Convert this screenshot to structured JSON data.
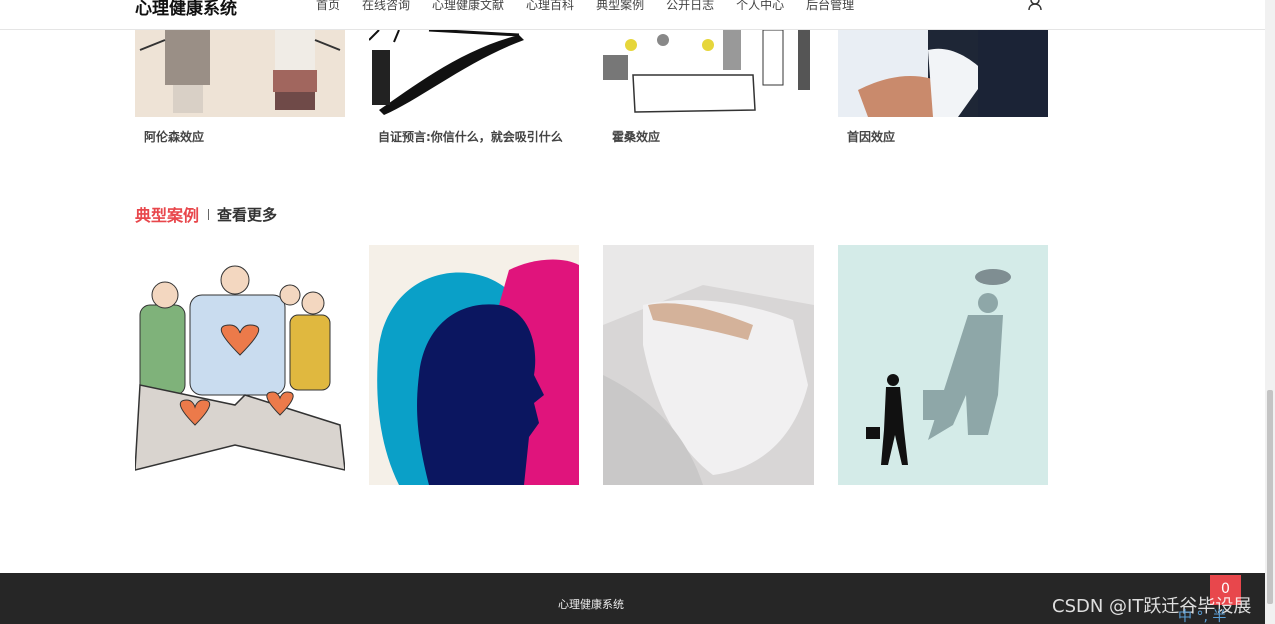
{
  "header": {
    "brand": "心理健康系统",
    "nav": [
      "首页",
      "在线咨询",
      "心理健康文献",
      "心理百科",
      "典型案例",
      "公开日志",
      "个人中心",
      "后台管理"
    ],
    "user_icon": "user-icon"
  },
  "effects": {
    "items": [
      {
        "title": "阿伦森效应",
        "image": "cartoon-couple-image"
      },
      {
        "title": "自证预言:你信什么，就会吸引什么",
        "image": "silhouette-sketch-image"
      },
      {
        "title": "霍桑效应",
        "image": "workers-sketch-image"
      },
      {
        "title": "首因效应",
        "image": "handshake-photo-image"
      }
    ]
  },
  "cases": {
    "title": "典型案例",
    "more": "查看更多",
    "items": [
      {
        "image": "family-hearts-illustration"
      },
      {
        "image": "face-profiles-illustration"
      },
      {
        "image": "pillow-photo"
      },
      {
        "image": "shadow-businessman-illustration"
      }
    ]
  },
  "footer": {
    "text": "心理健康系统"
  },
  "overlay": {
    "watermark": "CSDN @IT跃迁谷毕设展",
    "float_button": "0",
    "icons_text": "中 °, 半"
  }
}
